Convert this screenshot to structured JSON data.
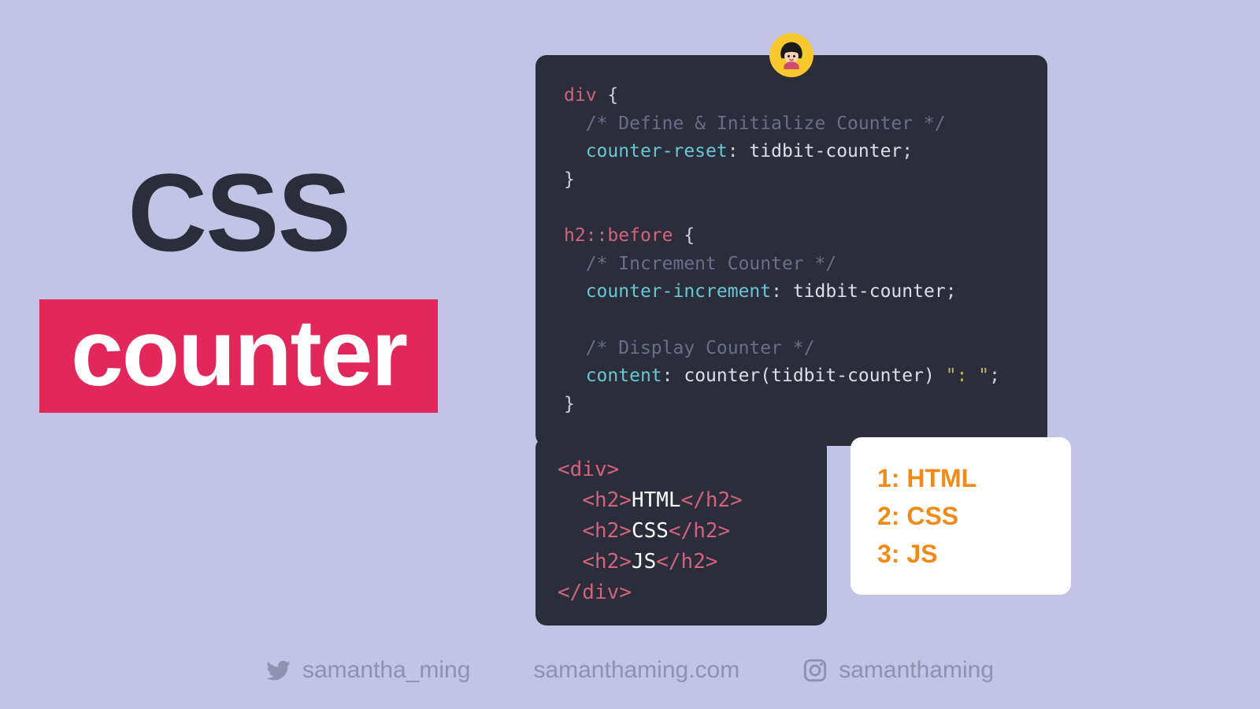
{
  "title": {
    "line1": "CSS",
    "line2": "counter"
  },
  "code": {
    "div_selector": "div",
    "open_brace": "{",
    "close_brace": "}",
    "comment_define": "/* Define & Initialize Counter */",
    "prop_reset": "counter-reset",
    "val_reset": "tidbit-counter",
    "h2_selector": "h2",
    "pseudo_before": "::before",
    "comment_increment": "/* Increment Counter */",
    "prop_increment": "counter-increment",
    "val_increment": "tidbit-counter",
    "comment_display": "/* Display Counter */",
    "prop_content": "content",
    "val_content_fn": "counter(tidbit-counter)",
    "val_content_str": "\": \""
  },
  "html": {
    "open_div": "<div>",
    "open_h2": "<h2>",
    "close_h2": "</h2>",
    "close_div": "</div>",
    "item1": "HTML",
    "item2": "CSS",
    "item3": "JS"
  },
  "output": {
    "line1": "1: HTML",
    "line2": "2: CSS",
    "line3": "3: JS"
  },
  "footer": {
    "twitter": "samantha_ming",
    "website": "samanthaming.com",
    "instagram": "samanthaming"
  }
}
